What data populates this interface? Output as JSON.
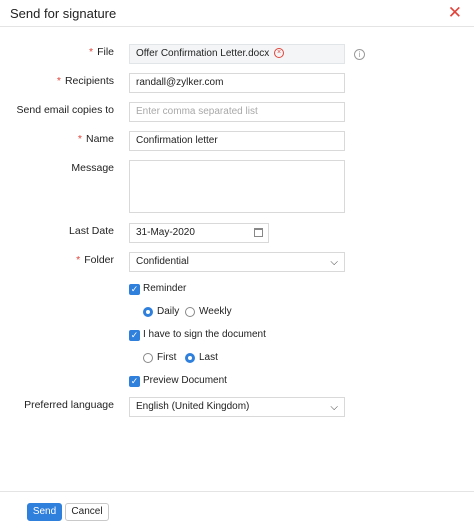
{
  "dialog": {
    "title": "Send for signature",
    "close_glyph": "✕"
  },
  "form": {
    "file": {
      "label": "File",
      "value": "Offer Confirmation Letter.docx",
      "remove_glyph": "×",
      "info_glyph": "i"
    },
    "recipients": {
      "label": "Recipients",
      "value": "randall@zylker.com"
    },
    "copies": {
      "label": "Send email copies to",
      "placeholder": "Enter comma separated list"
    },
    "name": {
      "label": "Name",
      "value": "Confirmation letter"
    },
    "message": {
      "label": "Message",
      "value": ""
    },
    "last_date": {
      "label": "Last Date",
      "value": "31-May-2020"
    },
    "folder": {
      "label": "Folder",
      "value": "Confidential"
    },
    "reminder": {
      "label": "Reminder",
      "checked": true
    },
    "frequency": {
      "options": [
        "Daily",
        "Weekly"
      ],
      "selected": "Daily"
    },
    "self_sign": {
      "label": "I have to sign the document",
      "checked": true
    },
    "order": {
      "options": [
        "First",
        "Last"
      ],
      "selected": "Last"
    },
    "preview": {
      "label": "Preview Document",
      "checked": true
    },
    "language": {
      "label": "Preferred language",
      "value": "English (United Kingdom)"
    },
    "required_mark": "*",
    "check_glyph": "✓",
    "dropdown_glyph": "⌵"
  },
  "footer": {
    "send_label": "Send",
    "cancel_label": "Cancel"
  },
  "colors": {
    "accent": "#2f7fdc",
    "required": "#e0443b"
  }
}
